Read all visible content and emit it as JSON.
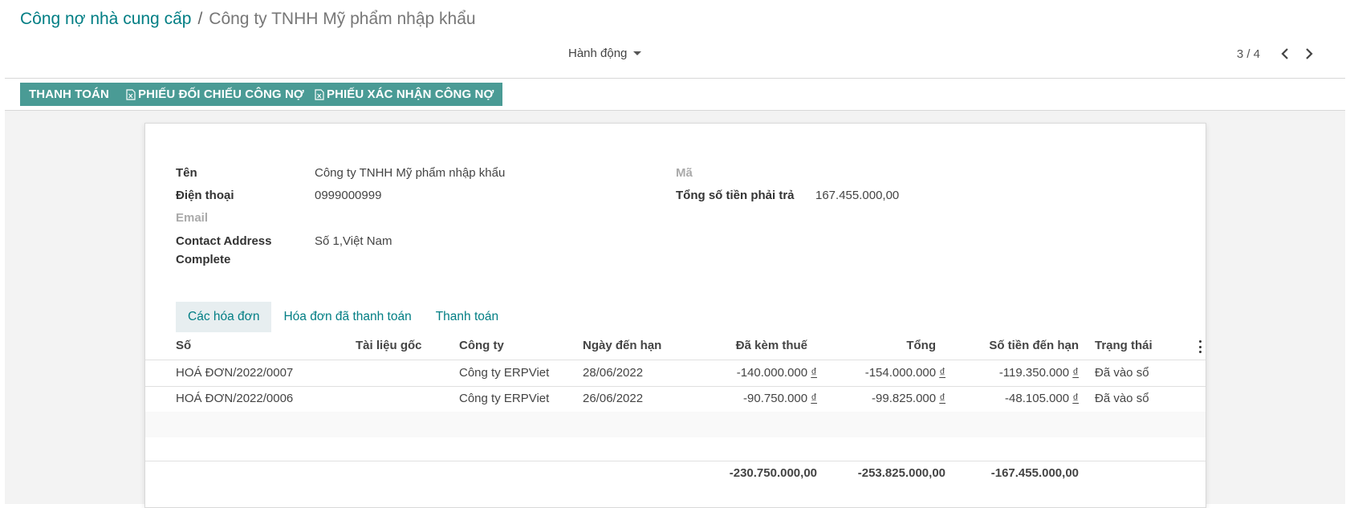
{
  "breadcrumb": {
    "parent": "Công nợ nhà cung cấp",
    "separator": "/",
    "current": "Công ty TNHH Mỹ phẩm nhập khẩu"
  },
  "action_menu": {
    "label": "Hành động",
    "icon": "caret-down-icon"
  },
  "pager": {
    "value": "3 / 4",
    "prev_icon": "chevron-left-icon",
    "next_icon": "chevron-right-icon"
  },
  "buttons": {
    "pay": "THANH TOÁN",
    "reconcile": "PHIẾU ĐỐI CHIẾU CÔNG NỢ",
    "confirm": "PHIẾU XÁC NHẬN CÔNG NỢ",
    "doc_icon": "file-excel-icon"
  },
  "colors": {
    "accent": "#017e84",
    "button_bg": "#4a9b95",
    "tab_active_bg": "#e7eef0"
  },
  "form": {
    "name_label": "Tên",
    "name_value": "Công ty TNHH Mỹ phẩm nhập khẩu",
    "phone_label": "Điện thoại",
    "phone_value": "0999000999",
    "email_label": "Email",
    "address_label_1": "Contact Address",
    "address_label_2": "Complete",
    "address_value": "Số 1,Việt Nam",
    "code_label": "Mã",
    "total_due_label": "Tổng số tiền phải trả",
    "total_due_value": "167.455.000,00"
  },
  "tabs": [
    "Các hóa đơn",
    "Hóa đơn đã thanh toán",
    "Thanh toán"
  ],
  "table": {
    "headers": {
      "number": "Số",
      "source": "Tài liệu gốc",
      "company": "Công ty",
      "due_date": "Ngày đến hạn",
      "tax_included": "Đã kèm thuế",
      "total": "Tổng",
      "amount_due": "Số tiền đến hạn",
      "status": "Trạng thái"
    },
    "rows": [
      {
        "number": "HOÁ ĐƠN/2022/0007",
        "source": "",
        "company": "Công ty ERPViet",
        "due_date": "28/06/2022",
        "tax_included": "-140.000.000",
        "total": "-154.000.000",
        "amount_due": "-119.350.000",
        "status": "Đã vào sổ"
      },
      {
        "number": "HOÁ ĐƠN/2022/0006",
        "source": "",
        "company": "Công ty ERPViet",
        "due_date": "26/06/2022",
        "tax_included": "-90.750.000",
        "total": "-99.825.000",
        "amount_due": "-48.105.000",
        "status": "Đã vào sổ"
      }
    ],
    "currency": "₫",
    "totals": {
      "tax_included": "-230.750.000,00",
      "total": "-253.825.000,00",
      "amount_due": "-167.455.000,00"
    },
    "options_icon": "kebab-vertical-icon"
  }
}
